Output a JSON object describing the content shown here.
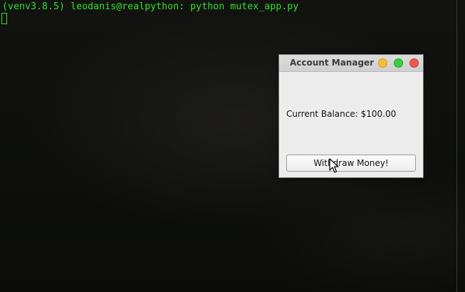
{
  "terminal": {
    "prompt_text": "(venv3.8.5) leodanis@realpython: python mutex_app.py",
    "text_color": "#33e02b"
  },
  "app_window": {
    "title": "Account Manager",
    "balance_label": "Current Balance: $100.00",
    "withdraw_button_label": "Withdraw Money!",
    "controls": {
      "minimize_color": "#f5bd38",
      "maximize_color": "#33cf3c",
      "close_color": "#ef5650"
    }
  }
}
